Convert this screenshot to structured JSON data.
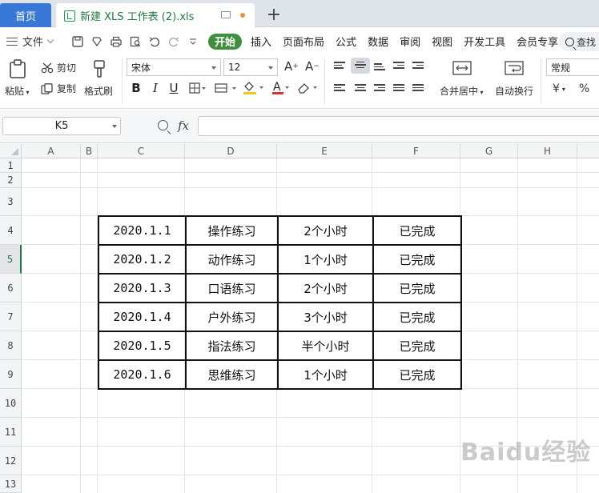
{
  "tabs": {
    "home": "首页",
    "document": "新建 XLS 工作表 (2).xls",
    "add": "+"
  },
  "menu": {
    "file": "文件",
    "items": [
      "开始",
      "插入",
      "页面布局",
      "公式",
      "数据",
      "审阅",
      "视图",
      "开发工具",
      "会员专享"
    ],
    "search": "查找"
  },
  "ribbon": {
    "paste": "粘贴",
    "cut": "剪切",
    "copy": "复制",
    "format_painter": "格式刷",
    "font_name": "宋体",
    "font_size": "12",
    "merge_center": "合并居中",
    "wrap_text": "自动换行",
    "number_format": "常规",
    "currency": "¥",
    "percent": "%"
  },
  "formula_bar": {
    "cell_ref": "K5",
    "fx": "fx",
    "value": ""
  },
  "grid": {
    "columns": [
      "A",
      "B",
      "C",
      "D",
      "E",
      "F",
      "G",
      "H"
    ],
    "rows": [
      "1",
      "2",
      "3",
      "4",
      "5",
      "6",
      "7",
      "8",
      "9",
      "10",
      "11",
      "12",
      "13"
    ],
    "active_row": "5",
    "table": [
      [
        "2020.1.1",
        "操作练习",
        "2个小时",
        "已完成"
      ],
      [
        "2020.1.2",
        "动作练习",
        "1个小时",
        "已完成"
      ],
      [
        "2020.1.3",
        "口语练习",
        "2个小时",
        "已完成"
      ],
      [
        "2020.1.4",
        "户外练习",
        "3个小时",
        "已完成"
      ],
      [
        "2020.1.5",
        "指法练习",
        "半个小时",
        "已完成"
      ],
      [
        "2020.1.6",
        "思维练习",
        "1个小时",
        "已完成"
      ]
    ]
  },
  "watermark": "Baidu经验",
  "colors": {
    "accent_green": "#1e7a43",
    "home_tab_blue": "#3a78d8",
    "start_pill": "#3f8f3f"
  }
}
